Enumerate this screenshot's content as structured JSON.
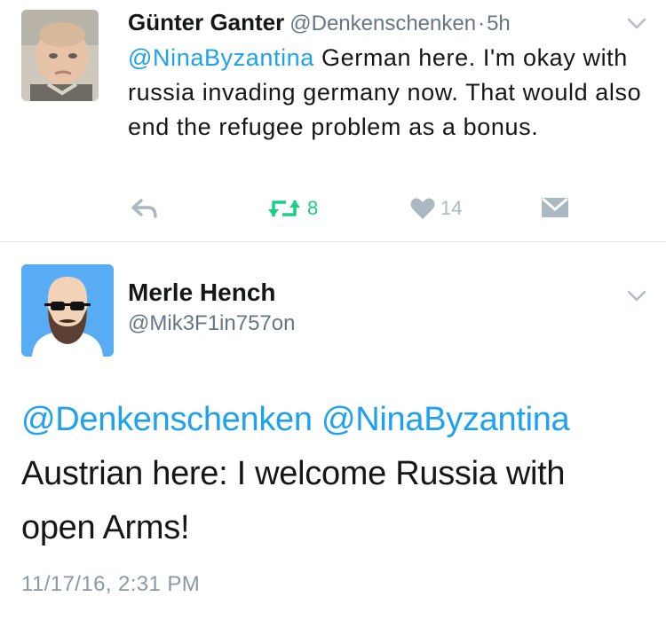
{
  "tweet1": {
    "author_name": "Günter Ganter",
    "author_handle": "@Denkenschenken",
    "separator": "·",
    "time": "5h",
    "mention": "@NinaByzantina",
    "text": " German here. I'm okay with russia invading germany now. That would also end the refugee problem as a bonus.",
    "retweet_count": "8",
    "like_count": "14",
    "icons": [
      "reply-icon",
      "retweet-icon",
      "like-icon",
      "dm-icon",
      "chevron-down-icon"
    ],
    "colors": {
      "retweet": "#19cf86",
      "muted": "#aab8c2",
      "link": "#1da1f2"
    }
  },
  "tweet2": {
    "author_name": "Merle Hench",
    "author_handle": "@Mik3F1in757on",
    "mentions": "@Denkenschenken @NinaByzantina",
    "text": "Austrian here: I welcome Russia with open Arms!",
    "timestamp": "11/17/16, 2:31 PM"
  }
}
